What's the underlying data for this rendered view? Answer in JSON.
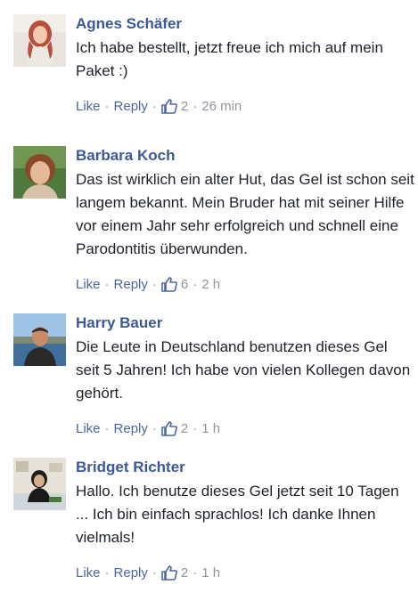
{
  "comments": [
    {
      "name": "Agnes Schäfer",
      "text": "Ich habe bestellt, jetzt freue ich mich auf mein Paket :)",
      "like_label": "Like",
      "reply_label": "Reply",
      "likes": "2",
      "time": "26 min",
      "avatar_icon": "avatar-photo"
    },
    {
      "name": "Barbara Koch",
      "text": "Das ist wirklich ein alter Hut, das Gel ist schon seit langem bekannt. Mein Bruder hat mit seiner Hilfe vor einem Jahr sehr erfolgreich und schnell eine Parodontitis überwunden.",
      "like_label": "Like",
      "reply_label": "Reply",
      "likes": "6",
      "time": "2 h",
      "avatar_icon": "avatar-photo"
    },
    {
      "name": "Harry Bauer",
      "text": "Die Leute in Deutschland benutzen dieses Gel seit 5 Jahren! Ich habe von vielen Kollegen davon gehört.",
      "like_label": "Like",
      "reply_label": "Reply",
      "likes": "2",
      "time": "1 h",
      "avatar_icon": "avatar-photo"
    },
    {
      "name": "Bridget Richter",
      "text": "Hallo. Ich benutze dieses Gel jetzt seit 10 Tagen ... Ich bin einfach sprachlos! Ich danke Ihnen vielmals!",
      "like_label": "Like",
      "reply_label": "Reply",
      "likes": "2",
      "time": "1 h",
      "avatar_icon": "avatar-photo"
    }
  ],
  "colors": {
    "name": "#3b5998",
    "link": "#4b67a1",
    "meta": "#90949c",
    "text": "#1d2129"
  }
}
